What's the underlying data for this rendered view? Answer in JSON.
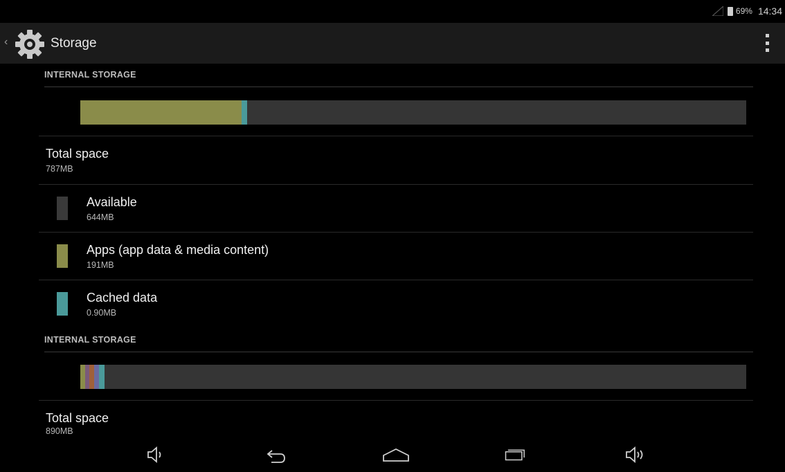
{
  "status_bar": {
    "battery": "69%",
    "time": "14:34",
    "icons": [
      "signal-icon",
      "battery-icon"
    ]
  },
  "action_bar": {
    "title": "Storage",
    "icons": [
      "back-chevron-icon",
      "gear-icon",
      "overflow-menu-icon"
    ]
  },
  "sections": [
    {
      "header": "INTERNAL STORAGE",
      "usage_segments": [
        {
          "label": "Apps",
          "fraction": 0.2427,
          "color": "#8a8c4a"
        },
        {
          "label": "Cached data",
          "fraction": 0.0075,
          "color": "#4a9a9a"
        }
      ],
      "total_label": "Total space",
      "total_value": "787MB",
      "items": [
        {
          "label": "Available",
          "value": "644MB",
          "color": "#3a3a3a"
        },
        {
          "label": "Apps (app data & media content)",
          "value": "191MB",
          "color": "#8a8c4a"
        },
        {
          "label": "Cached data",
          "value": "0.90MB",
          "color": "#4a9a9a"
        }
      ]
    },
    {
      "header": "INTERNAL STORAGE",
      "usage_segments": [
        {
          "fraction": 0.007,
          "color": "#8a8c4a"
        },
        {
          "fraction": 0.007,
          "color": "#7a5a7a"
        },
        {
          "fraction": 0.007,
          "color": "#a0603a"
        },
        {
          "fraction": 0.007,
          "color": "#6a6aa0"
        },
        {
          "fraction": 0.008,
          "color": "#4a9a9a"
        }
      ],
      "total_label": "Total space",
      "total_value": "890MB"
    }
  ],
  "nav_bar": {
    "icons": [
      "volume-down-icon",
      "back-icon",
      "home-icon",
      "recents-icon",
      "volume-up-icon"
    ]
  }
}
